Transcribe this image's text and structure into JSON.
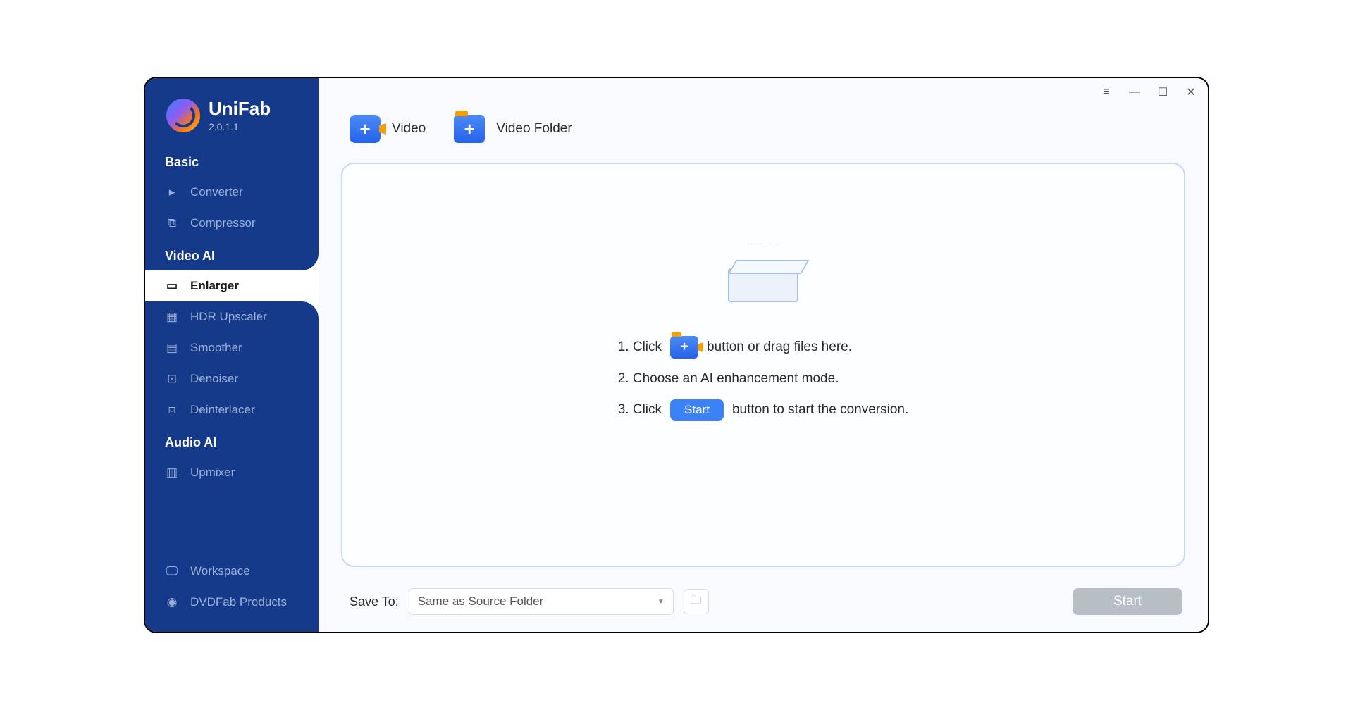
{
  "brand": {
    "name": "UniFab",
    "version": "2.0.1.1"
  },
  "sidebar": {
    "sections": [
      {
        "label": "Basic",
        "items": [
          {
            "label": "Converter",
            "icon": "play-icon"
          },
          {
            "label": "Compressor",
            "icon": "compress-icon"
          }
        ]
      },
      {
        "label": "Video AI",
        "items": [
          {
            "label": "Enlarger",
            "icon": "enlarge-icon",
            "active": true
          },
          {
            "label": "HDR Upscaler",
            "icon": "hdr-icon"
          },
          {
            "label": "Smoother",
            "icon": "smooth-icon"
          },
          {
            "label": "Denoiser",
            "icon": "denoise-icon"
          },
          {
            "label": "Deinterlacer",
            "icon": "deinterlace-icon"
          }
        ]
      },
      {
        "label": "Audio AI",
        "items": [
          {
            "label": "Upmixer",
            "icon": "upmix-icon"
          }
        ]
      }
    ],
    "bottom": [
      {
        "label": "Workspace",
        "icon": "monitor-icon"
      },
      {
        "label": "DVDFab Products",
        "icon": "dvdfab-icon"
      }
    ]
  },
  "topActions": {
    "video": "Video",
    "folder": "Video Folder"
  },
  "steps": {
    "s1_pre": "1. Click",
    "s1_post": "button or drag files here.",
    "s2": "2. Choose an AI enhancement mode.",
    "s3_pre": "3. Click",
    "s3_btn": "Start",
    "s3_post": "button to start the conversion."
  },
  "bottom": {
    "saveLabel": "Save To:",
    "saveValue": "Same as Source Folder",
    "startLabel": "Start"
  }
}
